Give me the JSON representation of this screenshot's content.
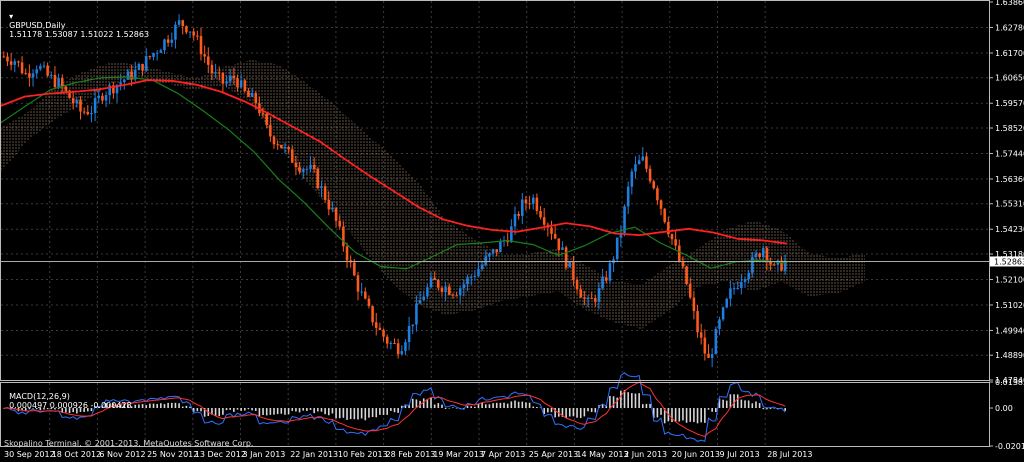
{
  "header": {
    "symbol_label": "GBPUSD,Daily",
    "ohlc_text": "1.51178 1.53087 1.51022 1.52863"
  },
  "macd_header": {
    "label": "MACD(12,26,9)",
    "values_text": "0.000497 0.000926 -0.000428"
  },
  "footer": {
    "copyright": "Skopalino Terminal, © 2001-2013, MetaQuotes Software Corp."
  },
  "current_price_label": "1.52863",
  "colors": {
    "background": "#000000",
    "grid": "#3a3a3a",
    "bull_candle": "#1e7fe0",
    "bear_candle": "#ff5a1e",
    "ma_fast": "#1a7f1a",
    "ma_slow": "#ff2020",
    "cloud_bull": "#f0c8a0",
    "cloud_bear": "#c8c0c0",
    "macd_hist": "#d8d8d8",
    "macd_line": "#3070ff",
    "signal_line": "#ff3030"
  },
  "chart_data": [
    {
      "type": "candlestick",
      "name": "price",
      "title": "GBPUSD,Daily",
      "y_ticks": [
        "1.63860",
        "1.62780",
        "1.61700",
        "1.60650",
        "1.59570",
        "1.58520",
        "1.57440",
        "1.56360",
        "1.55310",
        "1.54230",
        "1.53180",
        "1.52100",
        "1.51020",
        "1.49940",
        "1.48890",
        "1.47840"
      ],
      "ylim": [
        1.4784,
        1.6386
      ],
      "x_tick_labels": [
        "30 Sep 2012",
        "18 Oct 2012",
        "6 Nov 2012",
        "25 Nov 2012",
        "13 Dec 2012",
        "3 Jan 2013",
        "22 Jan 2013",
        "10 Feb 2013",
        "28 Feb 2013",
        "19 Mar 2013",
        "7 Apr 2013",
        "25 Apr 2013",
        "14 May 2013",
        "2 Jun 2013",
        "20 Jun 2013",
        "9 Jul 2013",
        "28 Jul 2013"
      ],
      "close_path": [
        1.6155,
        1.614,
        1.608,
        1.612,
        1.607,
        1.604,
        1.598,
        1.592,
        1.593,
        1.6,
        1.603,
        1.606,
        1.609,
        1.614,
        1.619,
        1.624,
        1.63,
        1.627,
        1.618,
        1.608,
        1.604,
        1.607,
        1.599,
        1.596,
        1.583,
        1.579,
        1.573,
        1.569,
        1.567,
        1.558,
        1.548,
        1.534,
        1.52,
        1.509,
        1.5,
        1.494,
        1.492,
        1.502,
        1.514,
        1.52,
        1.518,
        1.516,
        1.52,
        1.525,
        1.53,
        1.535,
        1.541,
        1.552,
        1.556,
        1.548,
        1.54,
        1.53,
        1.52,
        1.51,
        1.515,
        1.525,
        1.54,
        1.566,
        1.572,
        1.562,
        1.548,
        1.534,
        1.52,
        1.5,
        1.486,
        1.502,
        1.515,
        1.522,
        1.528,
        1.535,
        1.525,
        1.5286
      ],
      "ma_slow_path": [
        1.5945,
        1.5985,
        1.5998,
        1.6005,
        1.6015,
        1.6033,
        1.6055,
        1.6052,
        1.6035,
        1.6005,
        1.5962,
        1.5909,
        1.5852,
        1.5795,
        1.5722,
        1.5651,
        1.5585,
        1.5518,
        1.5465,
        1.5438,
        1.542,
        1.5412,
        1.543,
        1.5449,
        1.5435,
        1.5405,
        1.5398,
        1.5412,
        1.5425,
        1.5409,
        1.5382,
        1.5376,
        1.5362
      ],
      "ma_fast_path": [
        1.5872,
        1.5945,
        1.6015,
        1.6045,
        1.6065,
        1.6068,
        1.6055,
        1.5999,
        1.5925,
        1.5845,
        1.5751,
        1.5632,
        1.5535,
        1.5425,
        1.5325,
        1.5265,
        1.5255,
        1.5305,
        1.5358,
        1.5365,
        1.5375,
        1.5358,
        1.5312,
        1.5352,
        1.5405,
        1.5432,
        1.5365,
        1.5315,
        1.5258,
        1.5285,
        1.5292,
        1.5278
      ],
      "ichimoku_cloud": {
        "upper": [
          1.585,
          1.592,
          1.603,
          1.609,
          1.613,
          1.612,
          1.609,
          1.606,
          1.611,
          1.614,
          1.612,
          1.604,
          1.595,
          1.584,
          1.574,
          1.562,
          1.546,
          1.538,
          1.532,
          1.532,
          1.534,
          1.527,
          1.52,
          1.519,
          1.527,
          1.534,
          1.542,
          1.546,
          1.542,
          1.532,
          1.53,
          1.532
        ],
        "lower": [
          1.566,
          1.58,
          1.589,
          1.596,
          1.604,
          1.606,
          1.604,
          1.601,
          1.603,
          1.596,
          1.578,
          1.562,
          1.549,
          1.534,
          1.52,
          1.51,
          1.506,
          1.508,
          1.512,
          1.514,
          1.516,
          1.508,
          1.503,
          1.5,
          1.508,
          1.518,
          1.52,
          1.516,
          1.52,
          1.514,
          1.515,
          1.52
        ]
      }
    },
    {
      "type": "macd",
      "title": "MACD(12,26,9)",
      "values": [
        0.000497,
        0.000926,
        -0.000428
      ],
      "y_ticks": [
        "0.013834",
        "0.00",
        "-0.020181"
      ],
      "ylim": [
        -0.020181,
        0.013834
      ]
    }
  ]
}
